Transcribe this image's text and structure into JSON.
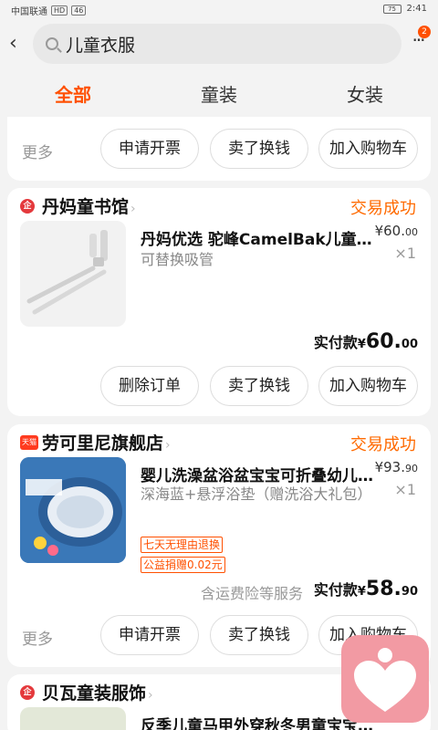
{
  "status_bar": {
    "carrier": "中国联通",
    "net1": "HD",
    "net2": "46",
    "battery": "75",
    "time": "2:41"
  },
  "search": {
    "text": "儿童衣服",
    "badge": "2"
  },
  "tabs": [
    "全部",
    "童装",
    "女装"
  ],
  "top_actions": {
    "more": "更多",
    "b1": "申请开票",
    "b2": "卖了换钱",
    "b3": "加入购物车"
  },
  "order1": {
    "shop": "丹妈童书馆",
    "status": "交易成功",
    "title": "丹妈优选 驼峰CamelBak儿童吸管杯",
    "price_int": "¥60.",
    "price_dec": "00",
    "qty": "×1",
    "spec": "可替换吸管",
    "paid_label": "实付款",
    "paid_yen": "¥",
    "paid_int": "60.",
    "paid_dec": "00",
    "b1": "删除订单",
    "b2": "卖了换钱",
    "b3": "加入购物车"
  },
  "order2": {
    "shop_badge": "天猫",
    "shop": "劳可里尼旗舰店",
    "status": "交易成功",
    "title": "婴儿洗澡盆浴盆宝宝可折叠幼儿浴盆",
    "price_int": "¥93.",
    "price_dec": "90",
    "qty": "×1",
    "spec": "深海蓝+悬浮浴垫（赠洗浴大礼包）",
    "tag1": "七天无理由退换",
    "tag2": "公益捐赠0.02元",
    "svc": "含运费险等服务",
    "paid_label": "实付款",
    "paid_yen": "¥",
    "paid_int": "58.",
    "paid_dec": "90",
    "more": "更多",
    "b1": "申请开票",
    "b2": "卖了换钱",
    "b3": "加入购物车"
  },
  "order3": {
    "shop": "贝瓦童装服饰",
    "title": "反季儿童马甲外穿秋冬男童宝宝马甲"
  },
  "colors": {
    "accent": "#ff5000",
    "status": "#ff6a00",
    "float": "#f29aa3"
  }
}
